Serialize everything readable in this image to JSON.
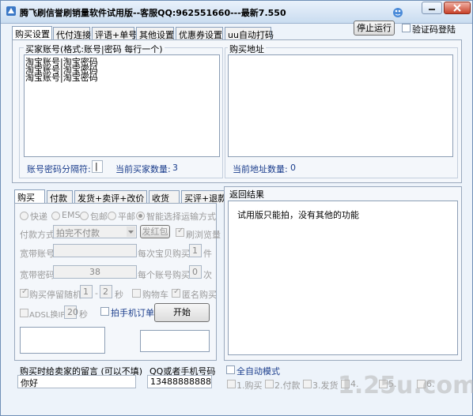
{
  "window": {
    "title": "腾飞刷信誉刷销量软件试用版--客服QQ:962551660---最新7.550"
  },
  "top_tabs": [
    "购买设置",
    "代付连接",
    "评语+单号",
    "其他设置",
    "优惠券设置",
    "uu自动打码"
  ],
  "top_buttons": {
    "stop_label": "停止运行",
    "captcha_label": "验证码登陆"
  },
  "buyer_accounts": {
    "label": "买家账号(格式:账号|密码 每行一个)",
    "lines": [
      "淘宝账号|淘宝密码",
      "淘宝账号|淘宝密码",
      "淘宝账号|淘宝密码"
    ],
    "separator_label": "账号密码分隔符:",
    "separator_value": "|",
    "count_label": "当前买家数量:",
    "count_value": "3"
  },
  "purchase_urls": {
    "label": "购买地址",
    "count_label": "当前地址数量:",
    "count_value": "0"
  },
  "lower_tabs": [
    "购买",
    "付款",
    "发货+卖评+改价",
    "收货",
    "买评+退款"
  ],
  "buy_settings": {
    "radios": [
      "快递",
      "EMS",
      "包邮",
      "平邮",
      "智能选择运输方式"
    ],
    "payment_label": "付款方式",
    "payment_value": "拍完不付款",
    "red_packet_label": "发红包",
    "brush_count_label": "刷浏览量",
    "broadband_account_label": "宽带账号",
    "broadband_password_label": "宽带密码",
    "broadband_password_value": "38",
    "per_item_label": "每次宝贝购买",
    "per_item_value": "1",
    "per_item_unit": "件",
    "per_account_label": "每个账号购买",
    "per_account_value": "0",
    "per_account_unit": "次",
    "random_stay_label": "购买停留随机",
    "random_from": "1",
    "random_to": "2",
    "random_unit": "秒",
    "cart_label": "购物车",
    "anonymous_label": "匿名购买",
    "adsl_label": "ADSL换IP",
    "adsl_value": "20",
    "adsl_unit": "秒",
    "phone_order_label": "拍手机订单",
    "start_label": "开始"
  },
  "return_results": {
    "label": "返回结果",
    "text": "试用版只能拍，没有其他的功能"
  },
  "message": {
    "label": "购买时给卖家的留言 (可以不填)",
    "value": "你好"
  },
  "phone": {
    "label": "QQ或者手机号码",
    "value": "13488888888"
  },
  "auto_mode": {
    "label": "全自动模式",
    "steps": [
      "1.购买",
      "2.付款",
      "3.发货",
      "4.",
      "5.",
      "6."
    ]
  },
  "watermark": "1.25u.com"
}
